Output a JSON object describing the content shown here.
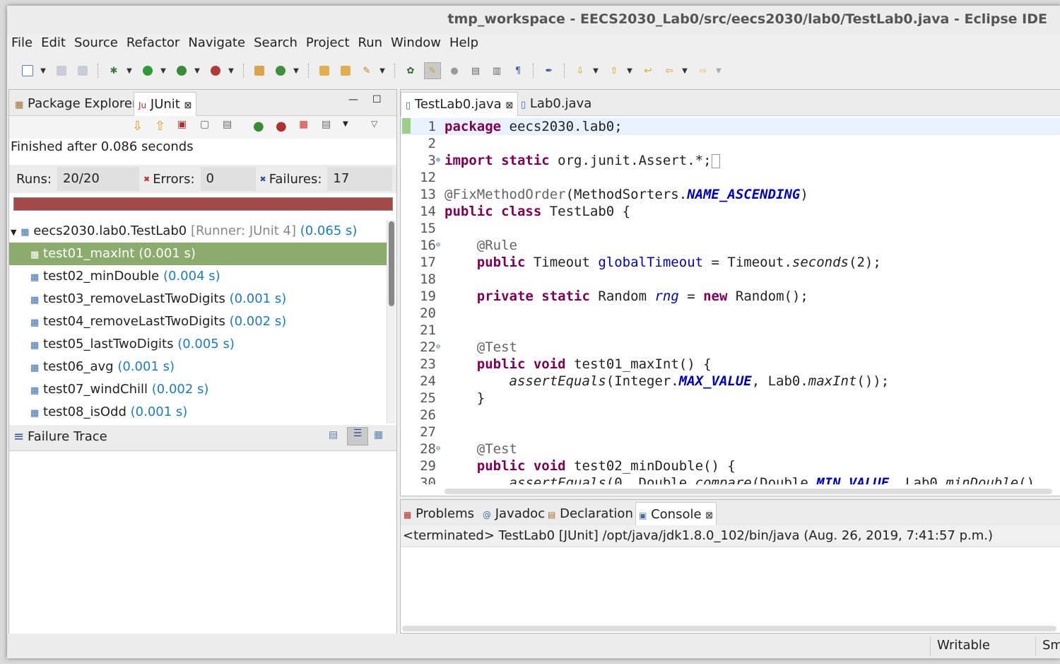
{
  "window": {
    "title": "tmp_workspace - EECS2030_Lab0/src/eecs2030/lab0/TestLab0.java - Eclipse IDE"
  },
  "menu": [
    "File",
    "Edit",
    "Source",
    "Refactor",
    "Navigate",
    "Search",
    "Project",
    "Run",
    "Window",
    "Help"
  ],
  "left": {
    "tabs": {
      "package_explorer": "Package Explorer",
      "junit": "JUnit"
    },
    "finished": "Finished after 0.086 seconds",
    "runs_label": "Runs:",
    "runs_value": "20/20",
    "errors_label": "Errors:",
    "errors_value": "0",
    "failures_label": "Failures:",
    "failures_value": "17",
    "root": {
      "name": "eecs2030.lab0.TestLab0",
      "runner": "[Runner: JUnit 4]",
      "time": "(0.065 s)"
    },
    "tests": [
      {
        "name": "test01_maxInt",
        "time": "(0.001 s)"
      },
      {
        "name": "test02_minDouble",
        "time": "(0.004 s)"
      },
      {
        "name": "test03_removeLastTwoDigits",
        "time": "(0.001 s)"
      },
      {
        "name": "test04_removeLastTwoDigits",
        "time": "(0.002 s)"
      },
      {
        "name": "test05_lastTwoDigits",
        "time": "(0.005 s)"
      },
      {
        "name": "test06_avg",
        "time": "(0.001 s)"
      },
      {
        "name": "test07_windChill",
        "time": "(0.002 s)"
      },
      {
        "name": "test08_isOdd",
        "time": "(0.001 s)"
      }
    ],
    "failure_trace": "Failure Trace"
  },
  "editor": {
    "tabs": {
      "active": "TestLab0.java",
      "other": "Lab0.java"
    },
    "line_numbers": [
      "1",
      "2",
      "3",
      "12",
      "13",
      "14",
      "15",
      "16",
      "17",
      "18",
      "19",
      "20",
      "21",
      "22",
      "23",
      "24",
      "25",
      "26",
      "27",
      "28",
      "29",
      "30"
    ]
  },
  "console": {
    "tabs": {
      "problems": "Problems",
      "javadoc": "Javadoc",
      "declaration": "Declaration",
      "console": "Console"
    },
    "terminated": "<terminated> TestLab0 [JUnit] /opt/java/jdk1.8.0_102/bin/java (Aug. 26, 2019, 7:41:57 p.m.)"
  },
  "status": {
    "writable": "Writable",
    "smart": "Sm"
  },
  "colors": {
    "progress_fail": "#a54848",
    "selected_row": "#8bac6c",
    "keyword": "#7f0055",
    "field": "#0000c0"
  }
}
